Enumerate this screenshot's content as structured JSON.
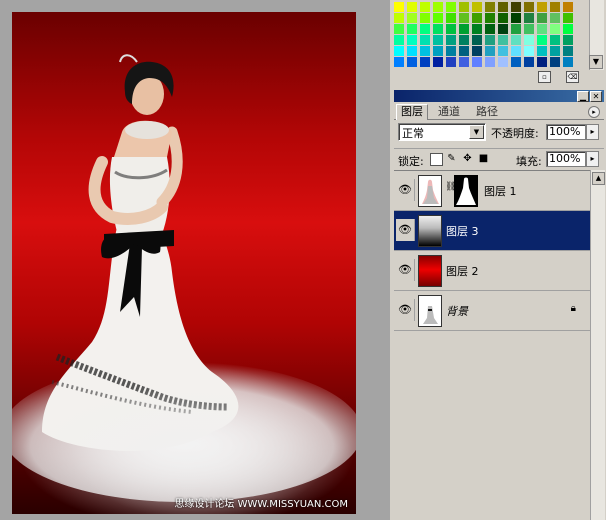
{
  "canvas": {
    "watermark": "思缘设计论坛 WWW.MISSYUAN.COM"
  },
  "swatches": {
    "rows": [
      [
        "#ffff00",
        "#dfff00",
        "#bfff00",
        "#9fff00",
        "#80ff00",
        "#a0c000",
        "#c0c000",
        "#808000",
        "#606000",
        "#404000",
        "#807000",
        "#c0a000",
        "#a08000",
        "#c08000"
      ],
      [
        "#c0ff00",
        "#a0ff20",
        "#80ff00",
        "#60ff00",
        "#40e000",
        "#60c020",
        "#40a000",
        "#208000",
        "#106000",
        "#004000",
        "#208040",
        "#40a040",
        "#60c060",
        "#40c000"
      ],
      [
        "#40ff40",
        "#20ff60",
        "#00ff80",
        "#00e060",
        "#00c040",
        "#00a030",
        "#008020",
        "#006010",
        "#004010",
        "#20a040",
        "#40c060",
        "#60e080",
        "#80ff80",
        "#00ff40"
      ],
      [
        "#00ffa0",
        "#00ffc0",
        "#00e0b0",
        "#00c0a0",
        "#00a080",
        "#008060",
        "#006050",
        "#20a080",
        "#40c0a0",
        "#60e0c0",
        "#80ffe0",
        "#00ff80",
        "#00c080",
        "#00a060"
      ],
      [
        "#00ffff",
        "#00e0ff",
        "#00c0e0",
        "#00a0c0",
        "#0080a0",
        "#006080",
        "#004060",
        "#20a0c0",
        "#40c0e0",
        "#60e0ff",
        "#80ffff",
        "#00c0c0",
        "#00a0a0",
        "#008080"
      ],
      [
        "#0080ff",
        "#0060e0",
        "#0040c0",
        "#0020a0",
        "#2040c0",
        "#4060e0",
        "#6080ff",
        "#80a0ff",
        "#a0c0ff",
        "#0060c0",
        "#0040a0",
        "#002080",
        "#004080",
        "#0080c0"
      ]
    ],
    "icons": {
      "new": "new-swatch-icon",
      "delete": "trash-icon"
    }
  },
  "layers_panel": {
    "tabs": [
      "图层",
      "通道",
      "路径"
    ],
    "blend_mode": "正常",
    "opacity_label": "不透明度:",
    "opacity_value": "100%",
    "lock_label": "锁定:",
    "fill_label": "填充:",
    "fill_value": "100%",
    "layers": [
      {
        "name": "图层 1",
        "visible": true,
        "has_mask": true,
        "selected": false
      },
      {
        "name": "图层 3",
        "visible": true,
        "has_mask": false,
        "selected": true
      },
      {
        "name": "图层 2",
        "visible": true,
        "has_mask": false,
        "selected": false
      },
      {
        "name": "背景",
        "visible": true,
        "has_mask": false,
        "selected": false,
        "locked": true
      }
    ]
  },
  "colors": {
    "titlebar": "#0a246a",
    "selection": "#0a246a",
    "panel_bg": "#d4d0c8",
    "photo_red": "#d80e0e"
  }
}
